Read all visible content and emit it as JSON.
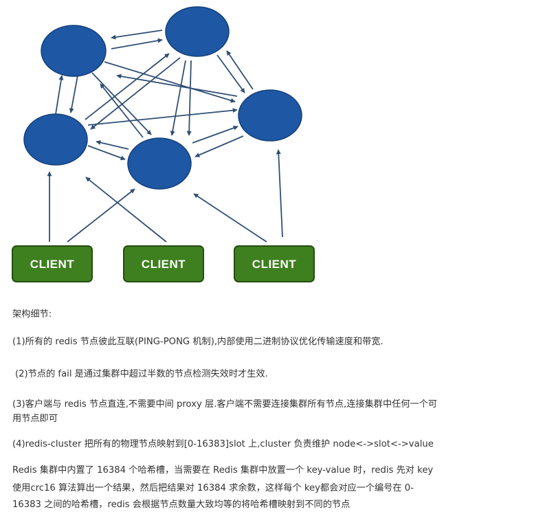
{
  "clients": [
    "CLIENT",
    "CLIENT",
    "CLIENT"
  ],
  "text": {
    "heading": "架构细节:",
    "p1": "(1)所有的 redis 节点彼此互联(PING-PONG 机制),内部使用二进制协议优化传输速度和带宽.",
    "p2": "(2)节点的 fail 是通过集群中超过半数的节点检测失效时才生效.",
    "p3a": "(3)客户端与 redis 节点直连,不需要中间 proxy 层.客户端不需要连接集群所有节点,连接集群中任何一个可",
    "p3b": "用节点即可",
    "p4": "(4)redis-cluster 把所有的物理节点映射到[0-16383]slot 上,cluster 负责维护 node<->slot<->value",
    "p5a": "Redis 集群中内置了 16384 个哈希槽，当需要在 Redis 集群中放置一个 key-value 时，redis 先对 key",
    "p5b": "使用crc16 算法算出一个结果，然后把结果对 16384 求余数，这样每个 key都会对应一个编号在 0-",
    "p5c": "16383  之间的哈希槽，redis  会根据节点数量大致均等的将哈希槽映射到不同的节点"
  },
  "colors": {
    "node": "#1e57a3",
    "client": "#3e7f1f",
    "arrow": "#2f4e73"
  }
}
